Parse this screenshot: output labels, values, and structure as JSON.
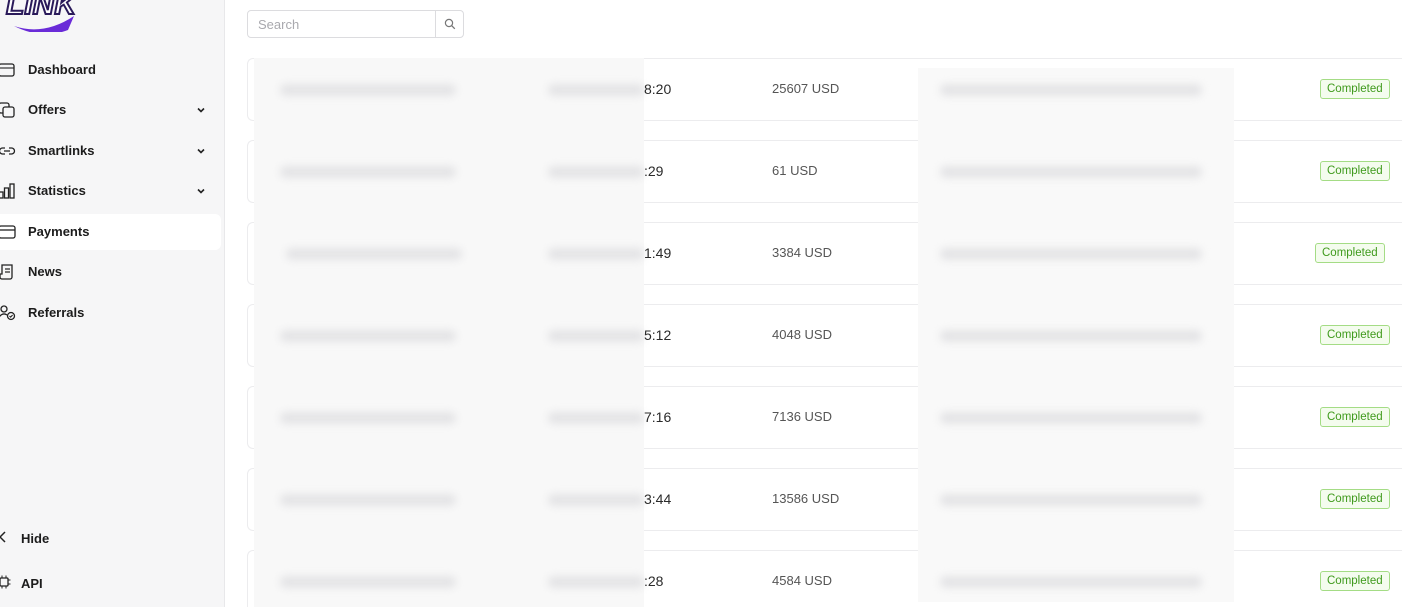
{
  "brand": {
    "logo_text": "LINK",
    "accent": "#6a2bd8"
  },
  "sidebar": {
    "items": [
      {
        "label": "Dashboard",
        "icon": "dashboard-icon",
        "has_chevron": false,
        "active": false
      },
      {
        "label": "Offers",
        "icon": "offers-icon",
        "has_chevron": true,
        "active": false
      },
      {
        "label": "Smartlinks",
        "icon": "link-icon",
        "has_chevron": true,
        "active": false
      },
      {
        "label": "Statistics",
        "icon": "bar-chart-icon",
        "has_chevron": true,
        "active": false
      },
      {
        "label": "Payments",
        "icon": "card-icon",
        "has_chevron": false,
        "active": true
      },
      {
        "label": "News",
        "icon": "news-icon",
        "has_chevron": false,
        "active": false
      },
      {
        "label": "Referrals",
        "icon": "referrals-icon",
        "has_chevron": false,
        "active": false
      }
    ],
    "hide_label": "Hide",
    "api_label": "API"
  },
  "search": {
    "placeholder": "Search",
    "value": ""
  },
  "payments": {
    "rows": [
      {
        "time": "8:20",
        "amount": "25607 USD",
        "status": "Completed"
      },
      {
        "time": ":29",
        "amount": "61 USD",
        "status": "Completed"
      },
      {
        "time": "1:49",
        "amount": "3384 USD",
        "status": "Completed"
      },
      {
        "time": "5:12",
        "amount": "4048 USD",
        "status": "Completed"
      },
      {
        "time": "7:16",
        "amount": "7136 USD",
        "status": "Completed"
      },
      {
        "time": "3:44",
        "amount": "13586 USD",
        "status": "Completed"
      },
      {
        "time": ":28",
        "amount": "4584 USD",
        "status": "Completed"
      }
    ]
  },
  "colors": {
    "status_completed": "#3f9a1c",
    "status_border": "#a4dc85",
    "sidebar_bg": "#f6f6f7"
  }
}
